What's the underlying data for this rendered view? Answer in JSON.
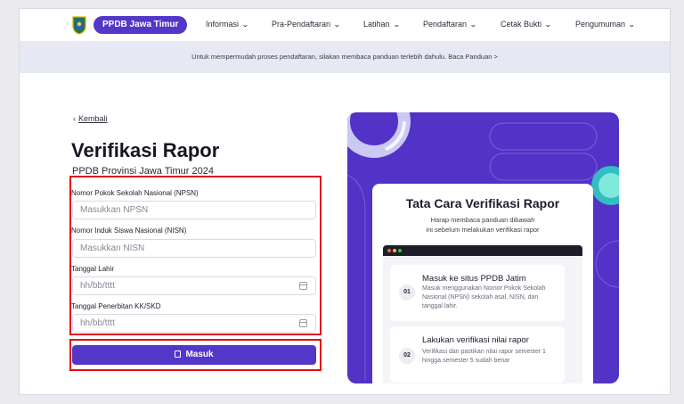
{
  "nav": {
    "brand": "PPDB Jawa Timur",
    "menu": [
      {
        "label": "Informasi"
      },
      {
        "label": "Pra-Pendaftaran"
      },
      {
        "label": "Latihan"
      },
      {
        "label": "Pendaftaran"
      },
      {
        "label": "Cetak Bukti"
      },
      {
        "label": "Pengumuman"
      }
    ]
  },
  "banner": {
    "text": "Untuk mempermudah proses pendaftaran, silakan membaca panduan terlebih dahulu. Baca Panduan >"
  },
  "page": {
    "back_label": "Kembali",
    "title": "Verifikasi Rapor",
    "subtitle": "PPDB Provinsi Jawa Timur 2024"
  },
  "form": {
    "npsn": {
      "label": "Nomor Pokok Sekolah Nasional (NPSN)",
      "placeholder": "Masukkan NPSN"
    },
    "nisn": {
      "label": "Nomor Induk Siswa Nasional (NISN)",
      "placeholder": "Masukkan NISN"
    },
    "tanggal_lahir": {
      "label": "Tanggal Lahir",
      "placeholder": "hh/bb/tttt"
    },
    "tanggal_kk": {
      "label": "Tanggal Penerbitan KK/SKD",
      "placeholder": "hh/bb/tttt"
    },
    "submit_label": "Masuk"
  },
  "panel": {
    "title": "Tata Cara Verifikasi Rapor",
    "subtitle_line1": "Harap membaca panduan dibawah",
    "subtitle_line2": "ini sebelum melakukan verifikasi rapor",
    "steps": [
      {
        "num": "01",
        "title": "Masuk ke situs PPDB Jatim",
        "desc": "Masuk menggunakan Nomor Pokok Sekolah Nasional (NPSN) sekolah asal, NISN, dan tanggal lahir."
      },
      {
        "num": "02",
        "title": "Lakukan verifikasi nilai rapor",
        "desc": "Verifikasi dan pastikan nilai rapor semester 1 hingga semester 5 sudah benar"
      }
    ]
  },
  "colors": {
    "brand": "#5436c9",
    "highlight": "#e01010",
    "banner": "#e6e8f4"
  }
}
